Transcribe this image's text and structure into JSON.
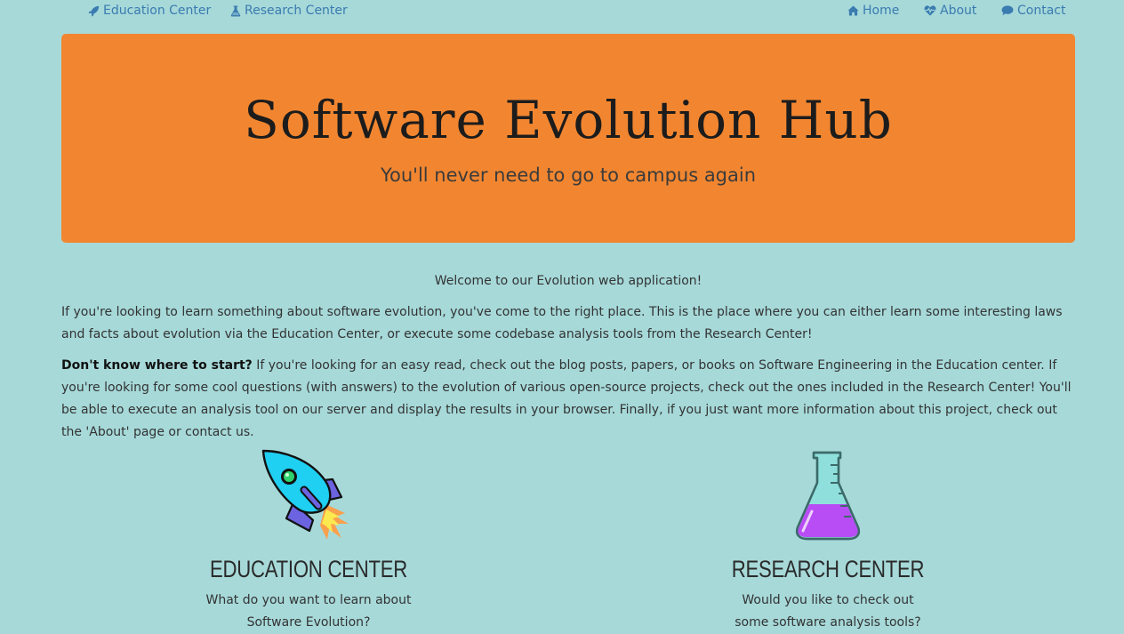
{
  "nav": {
    "education": "Education Center",
    "research": "Research Center",
    "home": "Home",
    "about": "About",
    "contact": "Contact"
  },
  "hero": {
    "title": "Software Evolution Hub",
    "subtitle": "You'll never need to go to campus again"
  },
  "intro": {
    "welcome": "Welcome to our Evolution web application!",
    "para1": "If you're looking to learn something about software evolution, you've come to the right place. This is the place where you can either learn some interesting laws and facts about evolution via the Education Center, or execute some codebase analysis tools from the Research Center!",
    "para2_bold": "Don't know where to start?",
    "para2_rest": " If you're looking for an easy read, check out the blog posts, papers, or books on Software Engineering in the Education center. If you're looking for some cool questions (with answers) to the evolution of various open-source projects, check out the ones included in the Research Center! You'll be able to execute an analysis tool on our server and display the results in your browser. Finally, if you just want more information about this project, check out the 'About' page or contact us."
  },
  "features": {
    "education": {
      "title": "EDUCATION CENTER",
      "description": "What do you want to learn about Software Evolution?",
      "icon": "rocket-icon"
    },
    "research": {
      "title": "RESEARCH CENTER",
      "description": "Would you like to check out some software analysis tools?",
      "icon": "flask-icon"
    }
  },
  "colors": {
    "background": "#a7d9d9",
    "hero": "#f28630",
    "link": "#3a7bb0"
  }
}
